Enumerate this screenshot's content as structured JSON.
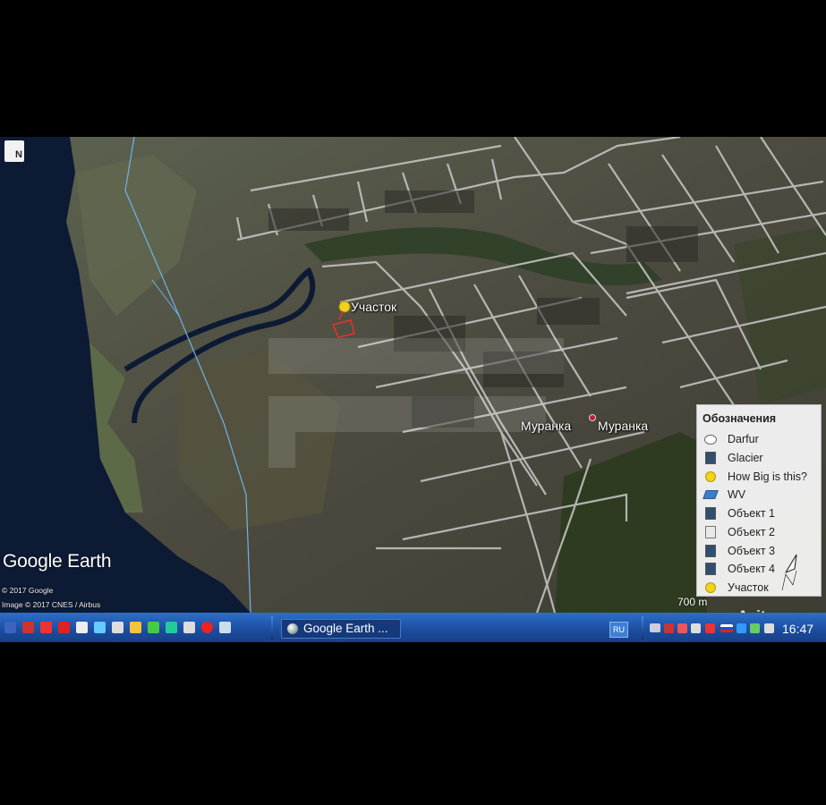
{
  "map": {
    "north_button": "N",
    "placemark_parcel": "Участок",
    "placemark_town_1": "Муранка",
    "placemark_town_2": "Муранка",
    "logo": "Google Earth",
    "credit_1": "© 2017 Google",
    "credit_2": "Image © 2017 CNES / Airbus",
    "scale_label": "700 m",
    "watermark_brand": "Avito"
  },
  "legend": {
    "title": "Обозначения",
    "items": [
      {
        "label": "Darfur",
        "icon": "shape-icon"
      },
      {
        "label": "Glacier",
        "icon": "document-icon"
      },
      {
        "label": "How Big is this?",
        "icon": "yellow-pin-icon"
      },
      {
        "label": "WV",
        "icon": "layers-icon"
      },
      {
        "label": "Объект 1",
        "icon": "document-icon"
      },
      {
        "label": "Объект 2",
        "icon": "document-icon"
      },
      {
        "label": "Объект 3",
        "icon": "document-icon"
      },
      {
        "label": "Объект 4",
        "icon": "document-icon"
      },
      {
        "label": "Участок",
        "icon": "yellow-pin-icon"
      }
    ]
  },
  "taskbar": {
    "active_window": "Google Earth ...",
    "language": "RU",
    "clock": "16:47"
  },
  "colors": {
    "water": "#0d1a33",
    "land": "#4a4f40",
    "road": "#cfcfcf",
    "taskbar": "#1c4fa3",
    "pin": "#f2d21c"
  }
}
